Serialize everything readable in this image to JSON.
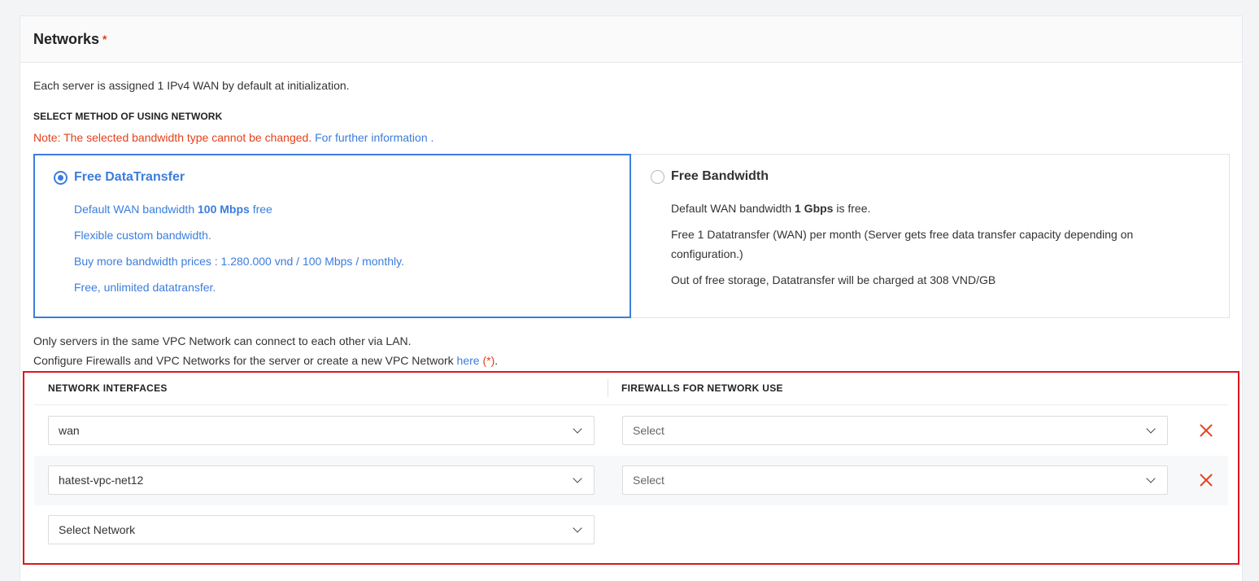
{
  "section": {
    "title": "Networks",
    "required_mark": "*",
    "intro": "Each server is assigned 1 IPv4 WAN by default at initialization.",
    "method_label": "SELECT METHOD OF USING NETWORK",
    "note_text": "Note: The selected bandwidth type cannot be changed.",
    "note_link": "For further information .",
    "accent_color": "#3b7ddd",
    "warning_color": "#e5401a"
  },
  "options": {
    "free_datatransfer": {
      "title": "Free DataTransfer",
      "selected": true,
      "line1_pre": "Default WAN bandwidth ",
      "line1_bold": "100 Mbps",
      "line1_post": " free",
      "line2": "Flexible custom bandwidth.",
      "line3": "Buy more bandwidth prices : 1.280.000 vnd / 100 Mbps / monthly.",
      "line4": "Free, unlimited datatransfer."
    },
    "free_bandwidth": {
      "title": "Free Bandwidth",
      "selected": false,
      "line1_pre": "Default WAN bandwidth ",
      "line1_bold": "1 Gbps",
      "line1_post": " is free.",
      "line2": "Free 1 Datatransfer (WAN) per month (Server gets free data transfer capacity depending on configuration.)",
      "line3": "Out of free storage, Datatransfer will be charged at 308 VND/GB"
    }
  },
  "vpc_info": {
    "line1": "Only servers in the same VPC Network can connect to each other via LAN.",
    "line2_pre": "Configure Firewalls and VPC Networks for the server or create a new VPC Network ",
    "line2_link": "here",
    "line2_mark": "(*)",
    "line2_post": "."
  },
  "network_table": {
    "col_interfaces": "NETWORK INTERFACES",
    "col_firewalls": "FIREWALLS FOR NETWORK USE",
    "rows": [
      {
        "network": "wan",
        "firewall_placeholder": "Select"
      },
      {
        "network": "hatest-vpc-net12",
        "firewall_placeholder": "Select"
      }
    ],
    "new_row_placeholder": "Select Network"
  }
}
